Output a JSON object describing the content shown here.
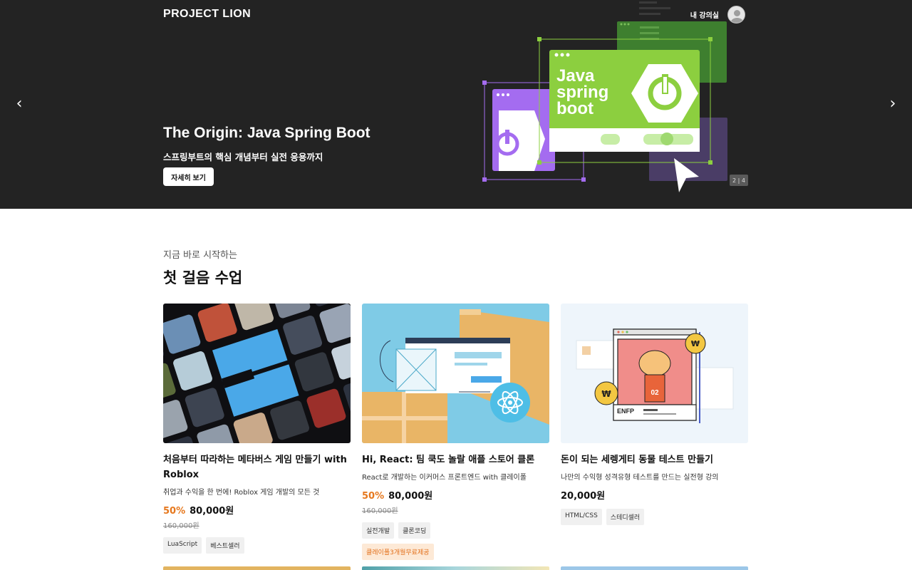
{
  "header": {
    "logo": "PROJECT LION",
    "nav_my_class": "내 강의실"
  },
  "hero": {
    "title": "The Origin: Java Spring Boot",
    "subtitle": "스프링부트의 핵심 개념부터 실전 응용까지",
    "button_label": "자세히 보기",
    "pager": "2 | 4",
    "art_text": [
      "Java",
      "spring",
      "boot"
    ],
    "colors": {
      "background": "#232323",
      "green": "#8ccf3f",
      "purple": "#a46cf0"
    }
  },
  "section": {
    "eyebrow": "지금 바로 시작하는",
    "title": "첫 걸음 수업"
  },
  "cards": [
    {
      "title": "처음부터 따라하는 메타버스 게임 만들기 with Roblox",
      "desc": "취업과 수익을 한 번에! Roblox 게임 개발의 모든 것",
      "discount": "50%",
      "price": "80,000원",
      "original_price": "160,000원",
      "tags": [
        "LuaScript",
        "베스트셀러"
      ],
      "promo": ""
    },
    {
      "title": "Hi, React: 팀 쿡도 놀랄 애플 스토어 클론",
      "desc": "React로 개발하는 이커머스 프론트엔드 with 클레이폴",
      "discount": "50%",
      "price": "80,000원",
      "original_price": "160,000원",
      "tags": [
        "실전개발",
        "클론코딩"
      ],
      "promo": "클레이폴3개월무료제공"
    },
    {
      "title": "돈이 되는 세렝게티 동물 테스트 만들기",
      "desc": "나만의 수익형 성격유형 테스트를 만드는 실전형 강의",
      "discount": "",
      "price": "20,000원",
      "original_price": "",
      "tags": [
        "HTML/CSS",
        "스테디셀러"
      ],
      "promo": ""
    }
  ],
  "card3_thumb_badge": "ENFP",
  "card3_thumb_number": "02"
}
